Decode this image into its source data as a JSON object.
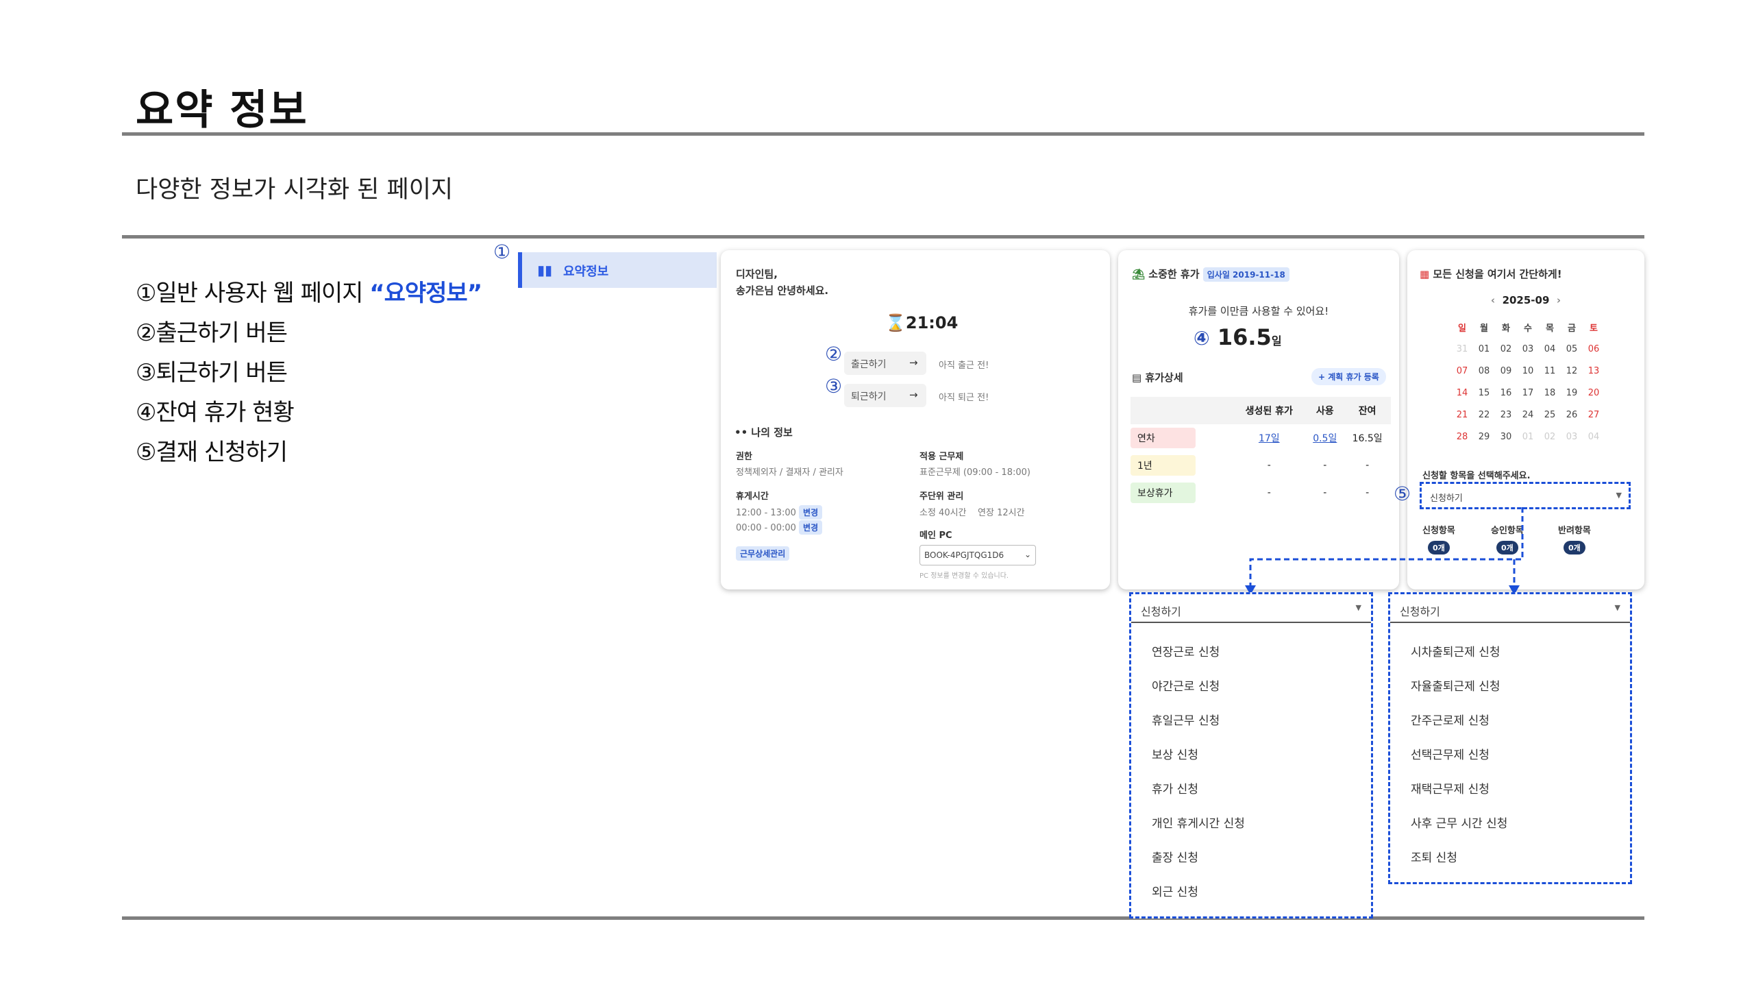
{
  "page": {
    "title": "요약 정보",
    "subtitle": "다양한 정보가 시각화 된 페이지"
  },
  "legend": [
    {
      "num": "①",
      "text": "일반 사용자 웹 페이지 ",
      "highlight": "“요약정보”"
    },
    {
      "num": "②",
      "text": "출근하기 버튼"
    },
    {
      "num": "③",
      "text": "퇴근하기 버튼"
    },
    {
      "num": "④",
      "text": "잔여 휴가 현황"
    },
    {
      "num": "⑤",
      "text": "결재 신청하기"
    }
  ],
  "markers": {
    "m1": "①",
    "m2": "②",
    "m3": "③",
    "m4": "④",
    "m5": "⑤"
  },
  "sidebar": {
    "item": "요약정보",
    "icon": "bar-chart-icon"
  },
  "greeting": {
    "line1": "디자인팀,",
    "line2": "송가은님 안녕하세요.",
    "time": "21:04",
    "clock_icon": "hourglass-icon"
  },
  "attendance": {
    "in_btn": "출근하기",
    "in_status": "아직 출근 전!",
    "out_btn": "퇴근하기",
    "out_status": "아직 퇴근 전!",
    "arrow": "→"
  },
  "myinfo": {
    "title": "나의 정보",
    "role_label": "권한",
    "role_value": "정책제외자 / 결재자 / 관리자",
    "break_label": "휴게시간",
    "break1": "12:00 - 13:00",
    "break2": "00:00 - 00:00",
    "change": "변경",
    "detail_btn": "근무상세관리",
    "work_label": "적용 근무제",
    "work_value": "표준근무제 (09:00 - 18:00)",
    "weekly_label": "주단위 관리",
    "weekly_value": "소정 40시간    연장 12시간",
    "pc_label": "메인 PC",
    "pc_value": "BOOK-4PGJTQG1D6",
    "pc_note": "PC 정보를 변경할 수 있습니다."
  },
  "vacation": {
    "title": "소중한 휴가",
    "join_badge": "입사일 2019-11-18",
    "message": "휴가를 이만큼 사용할 수 있어요!",
    "remaining": "16.5",
    "unit": "일",
    "detail_title": "휴가상세",
    "plan_btn": "+ 계획 휴가 등록",
    "headers": [
      "",
      "생성된 휴가",
      "사용",
      "잔여"
    ],
    "rows": [
      {
        "type": "연차",
        "created": "17일",
        "used": "0.5일",
        "left": "16.5일",
        "color": "#fde2e2"
      },
      {
        "type": "1년",
        "created": "-",
        "used": "-",
        "left": "-",
        "color": "#fdf6d8"
      },
      {
        "type": "보상휴가",
        "created": "-",
        "used": "-",
        "left": "-",
        "color": "#e3f6df"
      }
    ]
  },
  "request": {
    "title": "모든 신청을 여기서 간단하게!",
    "month": "2025-09",
    "prev": "‹",
    "next": "›",
    "weekdays": [
      "일",
      "월",
      "화",
      "수",
      "목",
      "금",
      "토"
    ],
    "weeks": [
      [
        "31",
        "01",
        "02",
        "03",
        "04",
        "05",
        "06"
      ],
      [
        "07",
        "08",
        "09",
        "10",
        "11",
        "12",
        "13"
      ],
      [
        "14",
        "15",
        "16",
        "17",
        "18",
        "19",
        "20"
      ],
      [
        "21",
        "22",
        "23",
        "24",
        "25",
        "26",
        "27"
      ],
      [
        "28",
        "29",
        "30",
        "01",
        "02",
        "03",
        "04"
      ]
    ],
    "select_label": "신청할 항목을 선택해주세요.",
    "select_value": "신청하기",
    "counters": [
      {
        "label": "신청항목",
        "count": "0개"
      },
      {
        "label": "승인항목",
        "count": "0개"
      },
      {
        "label": "반려항목",
        "count": "0개"
      }
    ]
  },
  "dropdown_left": {
    "value": "신청하기",
    "items": [
      "연장근로 신청",
      "야간근로 신청",
      "휴일근무 신청",
      "보상 신청",
      "휴가 신청",
      "개인 휴게시간 신청",
      "출장 신청",
      "외근 신청"
    ]
  },
  "dropdown_right": {
    "value": "신청하기",
    "items": [
      "시차출퇴근제 신청",
      "자율출퇴근제 신청",
      "간주근로제 신청",
      "선택근무제 신청",
      "재택근무제 신청",
      "사후 근무 시간 신청",
      "조퇴 신청"
    ]
  }
}
